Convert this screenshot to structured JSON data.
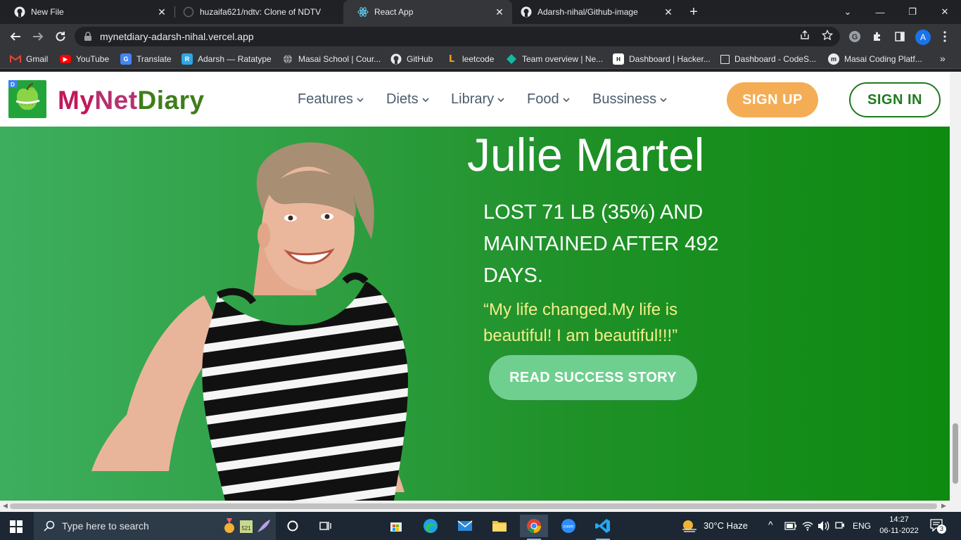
{
  "browser": {
    "tabs": [
      {
        "title": "New File",
        "icon": "github-icon"
      },
      {
        "title": "huzaifa621/ndtv: Clone of NDTV",
        "icon": "github-icon"
      },
      {
        "title": "React App",
        "icon": "react-icon",
        "active": true
      },
      {
        "title": "Adarsh-nihal/Github-image",
        "icon": "github-icon"
      }
    ],
    "url": "mynetdiary-adarsh-nihal.vercel.app",
    "profile_initial": "A",
    "bookmarks": [
      {
        "label": "Gmail",
        "icon": "gmail-icon"
      },
      {
        "label": "YouTube",
        "icon": "youtube-icon"
      },
      {
        "label": "Translate",
        "icon": "translate-icon"
      },
      {
        "label": "Adarsh — Ratatype",
        "icon": "ratatype-icon"
      },
      {
        "label": "Masai School | Cour...",
        "icon": "globe-icon"
      },
      {
        "label": "GitHub",
        "icon": "github-icon"
      },
      {
        "label": "leetcode",
        "icon": "leetcode-icon"
      },
      {
        "label": "Team overview | Ne...",
        "icon": "diamond-icon"
      },
      {
        "label": "Dashboard | Hacker...",
        "icon": "hackerrank-icon"
      },
      {
        "label": "Dashboard - CodeS...",
        "icon": "square-icon"
      },
      {
        "label": "Masai Coding Platf...",
        "icon": "masai-icon"
      }
    ]
  },
  "site": {
    "logo": {
      "my": "My",
      "net": "Net",
      "diary": "Diary"
    },
    "nav": [
      "Features",
      "Diets",
      "Library",
      "Food",
      "Bussiness"
    ],
    "signup_label": "SIGN UP",
    "signin_label": "SIGN IN"
  },
  "hero": {
    "name": "Julie Martel",
    "stat": "LOST 71 LB (35%) AND MAINTAINED AFTER 492 DAYS.",
    "quote": "“My life changed.My life is beautiful! I am beautiful!!!”",
    "cta": "READ SUCCESS STORY"
  },
  "taskbar": {
    "search_placeholder": "Type here to search",
    "weather": "30°C  Haze",
    "language": "ENG",
    "time": "14:27",
    "date": "06-11-2022",
    "notifications": "3"
  },
  "colors": {
    "brand_green": "#1f7a1f",
    "signup_orange": "#f4ad55",
    "hero_green": "#0e8a10",
    "quote_yellow": "#f4ee8a"
  }
}
